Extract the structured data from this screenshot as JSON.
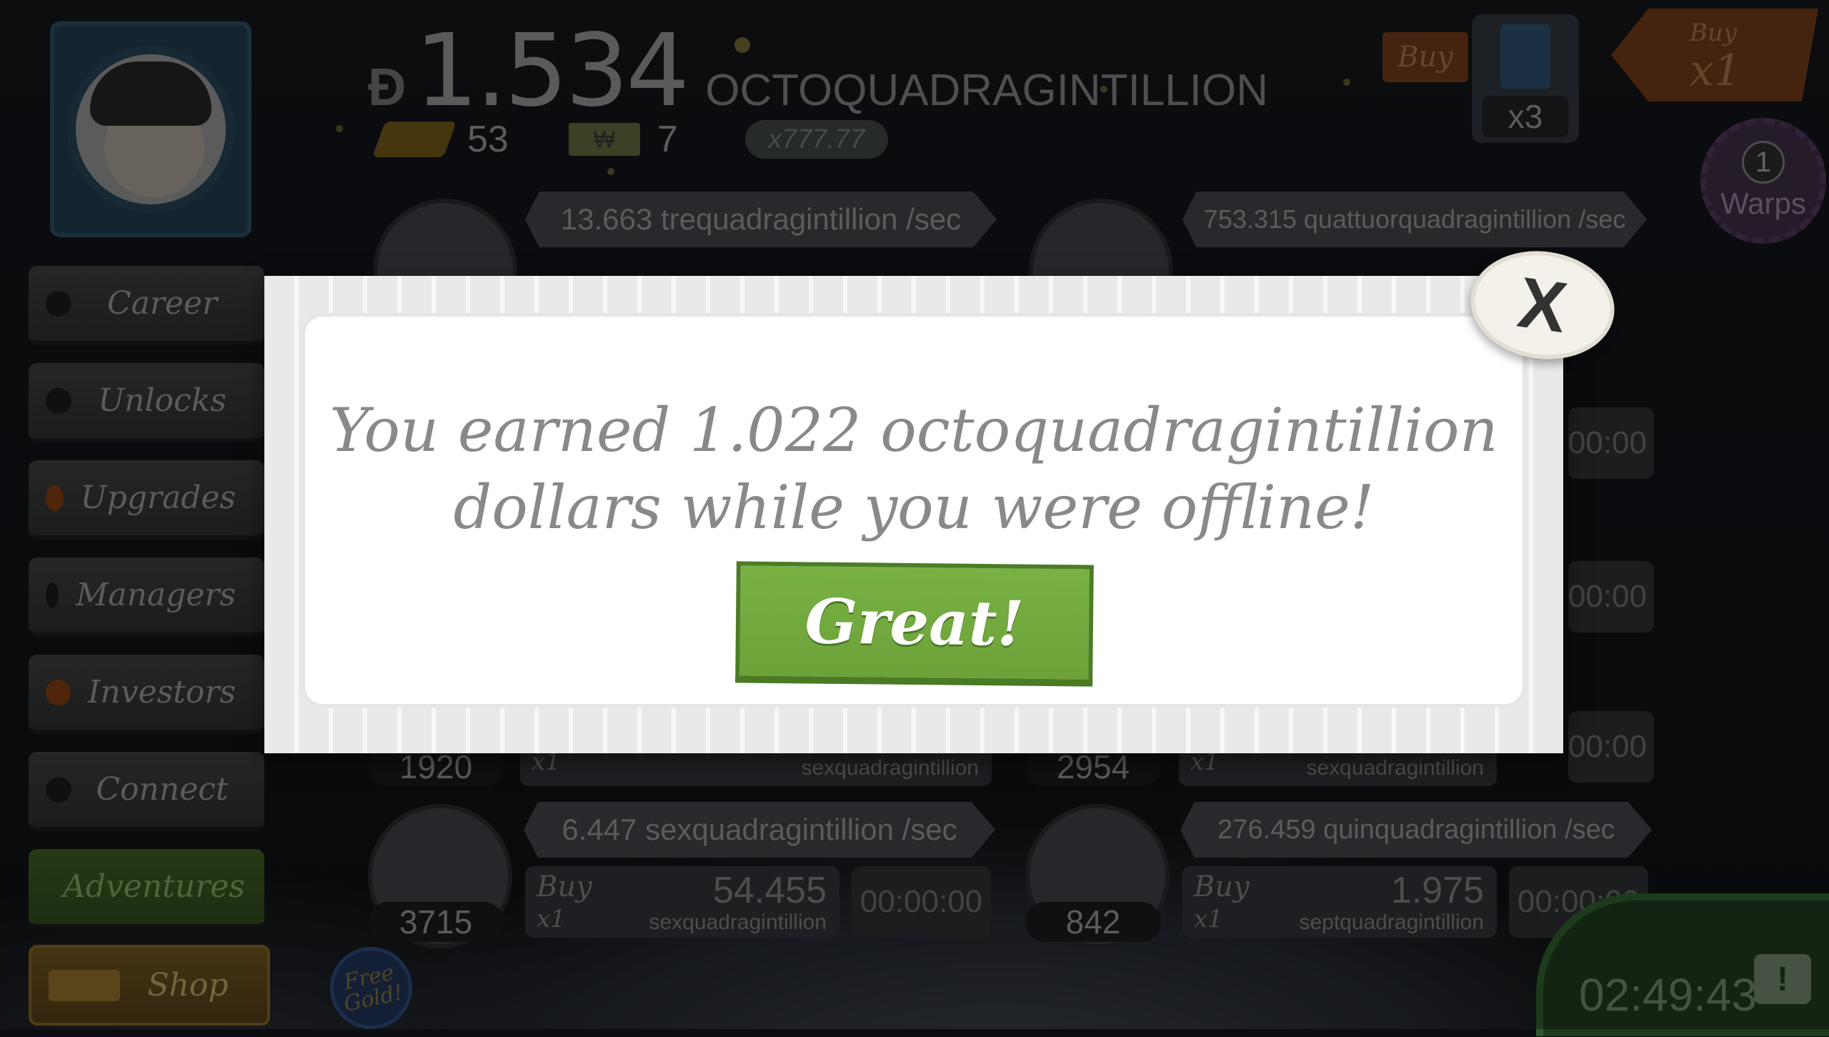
{
  "header": {
    "money_symbol": "Ð",
    "money_value": "1.534",
    "money_unit": "OCTOQUADRAGINTILLION",
    "gold_count": "53",
    "ticket_count": "7",
    "multiplier": "x777.77",
    "buy_small": "Buy",
    "tardis_count": "x3",
    "buy_tag_label": "Buy",
    "buy_tag_value": "x1",
    "warps_count": "1",
    "warps_label": "Warps"
  },
  "sidebar": {
    "items": [
      {
        "label": "Career"
      },
      {
        "label": "Unlocks"
      },
      {
        "label": "Upgrades"
      },
      {
        "label": "Managers"
      },
      {
        "label": "Investors"
      },
      {
        "label": "Connect"
      },
      {
        "label": "Adventures"
      },
      {
        "label": "Shop"
      }
    ]
  },
  "businesses": {
    "top_left_rate": "13.663 trequadragintillion /sec",
    "top_right_rate": "753.315 quattuorquadragintillion /sec",
    "mid_left_count": "1920",
    "mid_left_buy_mult": "x1",
    "mid_left_unit": "sexquadragintillion",
    "mid_right_count": "2954",
    "mid_right_buy_mult": "x1",
    "mid_right_unit": "sexquadragintillion",
    "bottom_left": {
      "rate": "6.447 sexquadragintillion /sec",
      "count": "3715",
      "buy_label": "Buy",
      "buy_mult": "x1",
      "cost": "54.455",
      "unit": "sexquadragintillion",
      "timer": "00:00:00"
    },
    "bottom_right": {
      "rate": "276.459 quinquadragintillion /sec",
      "count": "842",
      "buy_label": "Buy",
      "buy_mult": "x1",
      "cost": "1.975",
      "unit": "septquadragintillion",
      "timer": "00:00:00"
    },
    "right_timers": [
      "00:00",
      "00:00",
      "00:00"
    ]
  },
  "free_gold": "Free Gold!",
  "clock": "02:49:43",
  "dialog": {
    "message_line1": "You earned 1.022 octoquadragintillion",
    "message_line2": "dollars while you were offline!",
    "confirm_label": "Great!",
    "close_label": "X"
  }
}
